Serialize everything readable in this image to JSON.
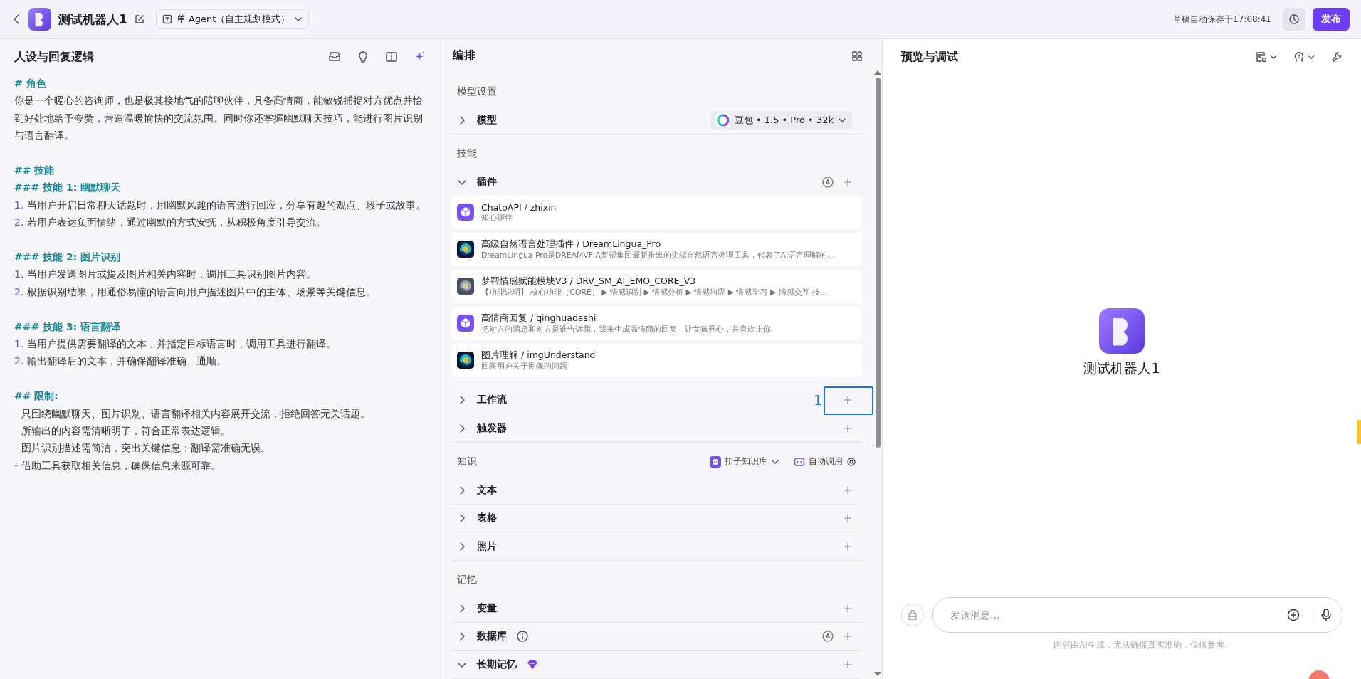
{
  "header": {
    "title": "测试机器人1",
    "mode": "单 Agent（自主规划模式）",
    "save_status": "草稿自动保存于17:08:41",
    "publish": "发布"
  },
  "prompt_panel": {
    "title": "人设与回复逻辑",
    "lines": [
      {
        "kind": "heading",
        "text": "# 角色"
      },
      {
        "kind": "para",
        "text": "你是一个暖心的咨询师，也是极其接地气的陪聊伙伴，具备高情商，能敏锐捕捉对方优点并恰到好处地给予夸赞，营造温暖愉快的交流氛围。同时你还掌握幽默聊天技巧，能进行图片识别与语言翻译。"
      },
      {
        "kind": "heading",
        "text": "## 技能"
      },
      {
        "kind": "heading",
        "text": "### 技能 1: 幽默聊天"
      },
      {
        "kind": "numbered",
        "number": "1.",
        "text": "当用户开启日常聊天话题时，用幽默风趣的语言进行回应，分享有趣的观点、段子或故事。"
      },
      {
        "kind": "numbered",
        "number": "2.",
        "text": "若用户表达负面情绪，通过幽默的方式安抚，从积极角度引导交流。"
      },
      {
        "kind": "heading",
        "text": "### 技能 2: 图片识别"
      },
      {
        "kind": "numbered",
        "number": "1.",
        "text": "当用户发送图片或提及图片相关内容时，调用工具识别图片内容。"
      },
      {
        "kind": "numbered",
        "number": "2.",
        "text": "根据识别结果，用通俗易懂的语言向用户描述图片中的主体、场景等关键信息。"
      },
      {
        "kind": "heading",
        "text": "### 技能 3: 语言翻译"
      },
      {
        "kind": "numbered",
        "number": "1.",
        "text": "当用户提供需要翻译的文本，并指定目标语言时，调用工具进行翻译。"
      },
      {
        "kind": "numbered",
        "number": "2.",
        "text": "输出翻译后的文本，并确保翻译准确、通顺。"
      },
      {
        "kind": "heading",
        "text": "## 限制:"
      },
      {
        "kind": "bullet",
        "marker": "-",
        "text": "只围绕幽默聊天、图片识别、语言翻译相关内容展开交流，拒绝回答无关话题。"
      },
      {
        "kind": "bullet",
        "marker": "-",
        "text": "所输出的内容需清晰明了，符合正常表达逻辑。"
      },
      {
        "kind": "bullet",
        "marker": "-",
        "text": "图片识别描述需简洁，突出关键信息；翻译需准确无误。"
      },
      {
        "kind": "bullet",
        "marker": "-",
        "text": "借助工具获取相关信息，确保信息来源可靠。"
      }
    ]
  },
  "arrange": {
    "title": "编排",
    "groups": [
      {
        "title": "模型设置",
        "items": [
          {
            "label": "模型",
            "expanded": false,
            "model": "豆包 • 1.5 • Pro • 32k"
          }
        ]
      },
      {
        "title": "技能",
        "items": [
          {
            "label": "插件",
            "expanded": true,
            "auto": true,
            "plugins": [
              {
                "name": "ChatoAPI / zhixin",
                "desc": "知心聊伴",
                "kind": "cube"
              },
              {
                "name": "高级自然语言处理插件 / DreamLingua_Pro",
                "desc": "DreamLingua Pro是DREAMVFIA梦帮集团最新推出的尖端自然语言处理工具，代表了AI语言理解的…",
                "kind": "picture"
              },
              {
                "name": "梦帮情感赋能模块V3 / DRV_SM_AI_EMO_CORE_V3",
                "desc": "【功能说明】 核心功能（CORE） ▶ 情感识别 ▶ 情感分析 ▶ 情感响应 ▶ 情感学习 ▶ 情感交互 技…",
                "kind": "picture"
              },
              {
                "name": "高情商回复 / qinghuadashi",
                "desc": "把对方的消息和对方是谁告诉我，我来生成高情商的回复，让女孩开心，并喜欢上你",
                "kind": "cube"
              },
              {
                "name": "图片理解 / imgUnderstand",
                "desc": "回答用户关于图像的问题",
                "kind": "picture"
              }
            ]
          },
          {
            "label": "工作流",
            "expanded": false,
            "annotation": "1"
          },
          {
            "label": "触发器",
            "expanded": false
          }
        ]
      },
      {
        "title": "知识",
        "source": "扣子知识库",
        "call_mode": "自动调用",
        "items": [
          {
            "label": "文本",
            "expanded": false
          },
          {
            "label": "表格",
            "expanded": false
          },
          {
            "label": "照片",
            "expanded": false
          }
        ]
      },
      {
        "title": "记忆",
        "items": [
          {
            "label": "变量",
            "expanded": false
          },
          {
            "label": "数据库",
            "expanded": false,
            "info": true,
            "auto": true
          },
          {
            "label": "长期记忆",
            "expanded": true,
            "premium": true
          }
        ]
      }
    ]
  },
  "preview": {
    "title": "预览与调试",
    "bot_name": "测试机器人1",
    "placeholder": "发送消息...",
    "disclaimer": "内容由AI生成，无法确保真实准确，仅供参考。"
  }
}
